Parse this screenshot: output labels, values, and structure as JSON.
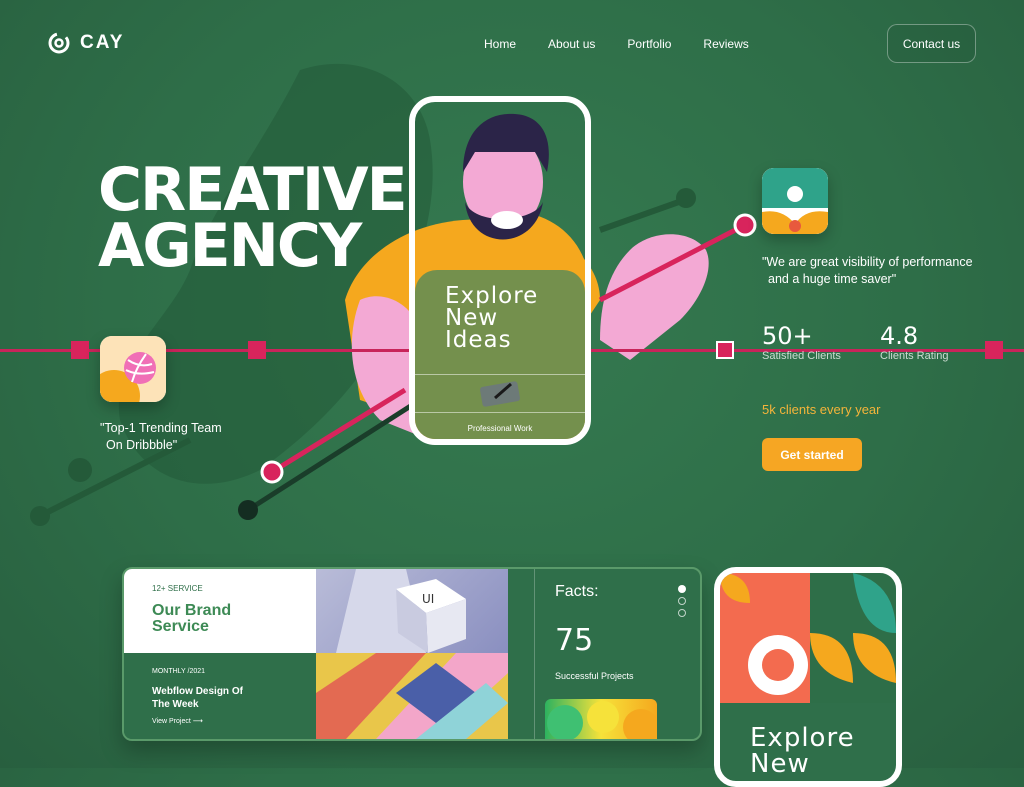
{
  "brand": {
    "name": "CAY"
  },
  "nav": {
    "items": [
      "Home",
      "About us",
      "Portfolio",
      "Reviews"
    ],
    "contact": "Contact us"
  },
  "hero": {
    "title_line1": "CREATIVE",
    "title_line2": "AGENCY"
  },
  "left_quote": {
    "line1": "\"Top-1 Trending Team",
    "line2": "On Dribbble\""
  },
  "phone": {
    "headline_line1": "Explore",
    "headline_line2": "New",
    "headline_line3": "Ideas",
    "caption": "Professional Work"
  },
  "right_quote": {
    "line1": "\"We are great visibility of performance",
    "line2": "and a huge time saver\""
  },
  "stats": [
    {
      "value": "50+",
      "label": "Satisfied Clients"
    },
    {
      "value": "4.8",
      "label": "Clients Rating"
    }
  ],
  "clients_year": "5k clients every year",
  "cta": "Get started",
  "card": {
    "brand_kicker": "12+ SERVICE",
    "brand_title_line1": "Our Brand",
    "brand_title_line2": "Service",
    "cube_text": "UI",
    "week_kicker": "MONTHLY /2021",
    "week_title_line1": "Webflow Design Of",
    "week_title_line2": "The Week",
    "week_link": "View Project",
    "facts_title": "Facts:",
    "facts_number": "75",
    "facts_label": "Successful Projects"
  },
  "phone2": {
    "line1": "Explore",
    "line2": "New"
  },
  "colors": {
    "background": "#2e6e48",
    "accent_pink": "#d8245c",
    "accent_orange": "#f6a623"
  }
}
